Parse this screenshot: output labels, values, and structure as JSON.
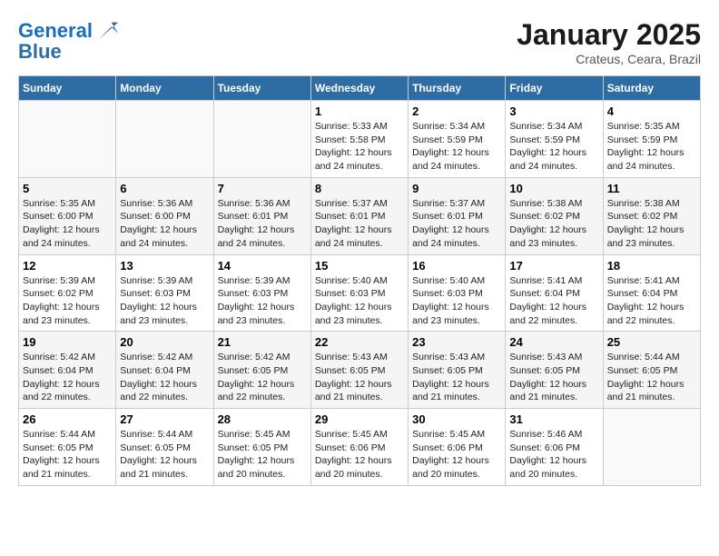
{
  "header": {
    "logo_line1": "General",
    "logo_line2": "Blue",
    "month": "January 2025",
    "location": "Crateus, Ceara, Brazil"
  },
  "weekdays": [
    "Sunday",
    "Monday",
    "Tuesday",
    "Wednesday",
    "Thursday",
    "Friday",
    "Saturday"
  ],
  "weeks": [
    [
      {
        "day": "",
        "info": ""
      },
      {
        "day": "",
        "info": ""
      },
      {
        "day": "",
        "info": ""
      },
      {
        "day": "1",
        "info": "Sunrise: 5:33 AM\nSunset: 5:58 PM\nDaylight: 12 hours and 24 minutes."
      },
      {
        "day": "2",
        "info": "Sunrise: 5:34 AM\nSunset: 5:59 PM\nDaylight: 12 hours and 24 minutes."
      },
      {
        "day": "3",
        "info": "Sunrise: 5:34 AM\nSunset: 5:59 PM\nDaylight: 12 hours and 24 minutes."
      },
      {
        "day": "4",
        "info": "Sunrise: 5:35 AM\nSunset: 5:59 PM\nDaylight: 12 hours and 24 minutes."
      }
    ],
    [
      {
        "day": "5",
        "info": "Sunrise: 5:35 AM\nSunset: 6:00 PM\nDaylight: 12 hours and 24 minutes."
      },
      {
        "day": "6",
        "info": "Sunrise: 5:36 AM\nSunset: 6:00 PM\nDaylight: 12 hours and 24 minutes."
      },
      {
        "day": "7",
        "info": "Sunrise: 5:36 AM\nSunset: 6:01 PM\nDaylight: 12 hours and 24 minutes."
      },
      {
        "day": "8",
        "info": "Sunrise: 5:37 AM\nSunset: 6:01 PM\nDaylight: 12 hours and 24 minutes."
      },
      {
        "day": "9",
        "info": "Sunrise: 5:37 AM\nSunset: 6:01 PM\nDaylight: 12 hours and 24 minutes."
      },
      {
        "day": "10",
        "info": "Sunrise: 5:38 AM\nSunset: 6:02 PM\nDaylight: 12 hours and 23 minutes."
      },
      {
        "day": "11",
        "info": "Sunrise: 5:38 AM\nSunset: 6:02 PM\nDaylight: 12 hours and 23 minutes."
      }
    ],
    [
      {
        "day": "12",
        "info": "Sunrise: 5:39 AM\nSunset: 6:02 PM\nDaylight: 12 hours and 23 minutes."
      },
      {
        "day": "13",
        "info": "Sunrise: 5:39 AM\nSunset: 6:03 PM\nDaylight: 12 hours and 23 minutes."
      },
      {
        "day": "14",
        "info": "Sunrise: 5:39 AM\nSunset: 6:03 PM\nDaylight: 12 hours and 23 minutes."
      },
      {
        "day": "15",
        "info": "Sunrise: 5:40 AM\nSunset: 6:03 PM\nDaylight: 12 hours and 23 minutes."
      },
      {
        "day": "16",
        "info": "Sunrise: 5:40 AM\nSunset: 6:03 PM\nDaylight: 12 hours and 23 minutes."
      },
      {
        "day": "17",
        "info": "Sunrise: 5:41 AM\nSunset: 6:04 PM\nDaylight: 12 hours and 22 minutes."
      },
      {
        "day": "18",
        "info": "Sunrise: 5:41 AM\nSunset: 6:04 PM\nDaylight: 12 hours and 22 minutes."
      }
    ],
    [
      {
        "day": "19",
        "info": "Sunrise: 5:42 AM\nSunset: 6:04 PM\nDaylight: 12 hours and 22 minutes."
      },
      {
        "day": "20",
        "info": "Sunrise: 5:42 AM\nSunset: 6:04 PM\nDaylight: 12 hours and 22 minutes."
      },
      {
        "day": "21",
        "info": "Sunrise: 5:42 AM\nSunset: 6:05 PM\nDaylight: 12 hours and 22 minutes."
      },
      {
        "day": "22",
        "info": "Sunrise: 5:43 AM\nSunset: 6:05 PM\nDaylight: 12 hours and 21 minutes."
      },
      {
        "day": "23",
        "info": "Sunrise: 5:43 AM\nSunset: 6:05 PM\nDaylight: 12 hours and 21 minutes."
      },
      {
        "day": "24",
        "info": "Sunrise: 5:43 AM\nSunset: 6:05 PM\nDaylight: 12 hours and 21 minutes."
      },
      {
        "day": "25",
        "info": "Sunrise: 5:44 AM\nSunset: 6:05 PM\nDaylight: 12 hours and 21 minutes."
      }
    ],
    [
      {
        "day": "26",
        "info": "Sunrise: 5:44 AM\nSunset: 6:05 PM\nDaylight: 12 hours and 21 minutes."
      },
      {
        "day": "27",
        "info": "Sunrise: 5:44 AM\nSunset: 6:05 PM\nDaylight: 12 hours and 21 minutes."
      },
      {
        "day": "28",
        "info": "Sunrise: 5:45 AM\nSunset: 6:05 PM\nDaylight: 12 hours and 20 minutes."
      },
      {
        "day": "29",
        "info": "Sunrise: 5:45 AM\nSunset: 6:06 PM\nDaylight: 12 hours and 20 minutes."
      },
      {
        "day": "30",
        "info": "Sunrise: 5:45 AM\nSunset: 6:06 PM\nDaylight: 12 hours and 20 minutes."
      },
      {
        "day": "31",
        "info": "Sunrise: 5:46 AM\nSunset: 6:06 PM\nDaylight: 12 hours and 20 minutes."
      },
      {
        "day": "",
        "info": ""
      }
    ]
  ]
}
